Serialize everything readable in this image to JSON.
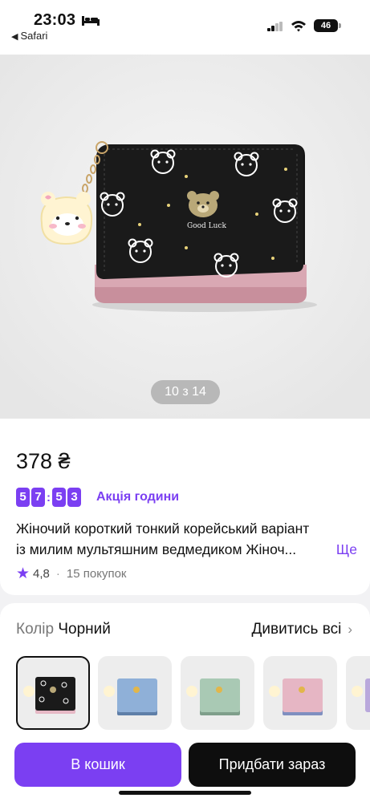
{
  "status_bar": {
    "time": "23:03",
    "back_label": "Safari",
    "battery": "46"
  },
  "gallery": {
    "counter": "10 з 14",
    "print_text": "Good Luck"
  },
  "product": {
    "price": "378 ₴",
    "timer": [
      "5",
      "7",
      "5",
      "3"
    ],
    "promo_label": "Акція години",
    "title_line1": "Жіночий короткий тонкий корейський варіант",
    "title_line2": "із милим мультяшним ведмедиком Жіноч...",
    "more_label": "Ще",
    "rating": "4,8",
    "sold": "15 покупок"
  },
  "colors": {
    "label": "Колір",
    "selected": "Чорний",
    "see_all": "Дивитись всі",
    "swatches": [
      {
        "name": "black",
        "color": "#1a1a1a",
        "bottom": "#e6b8c5"
      },
      {
        "name": "blue",
        "color": "#8fb0d8",
        "bottom": "#5f7fa8"
      },
      {
        "name": "green",
        "color": "#a9c9b4",
        "bottom": "#7f9f8b"
      },
      {
        "name": "pink",
        "color": "#e6b6c4",
        "bottom": "#7f8fc0"
      },
      {
        "name": "purple",
        "color": "#b9a8dc",
        "bottom": "#e8c6d2"
      }
    ]
  },
  "actions": {
    "cart": "В кошик",
    "buy": "Придбати зараз"
  },
  "accent": "#7b3ff2"
}
